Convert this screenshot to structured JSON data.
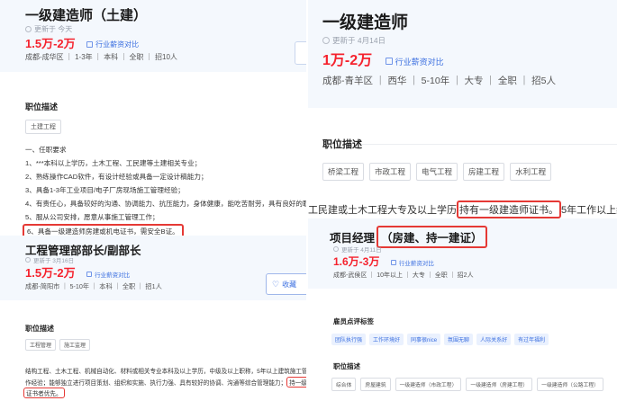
{
  "left": {
    "job1": {
      "title": "一级建造师（土建）",
      "updated": "更新于 今天",
      "salary": "1.5万-2万",
      "compare": "行业薪资对比",
      "meta": "成都-成华区 ｜ 1-3年 ｜ 本科 ｜ 全职 ｜ 招10人"
    },
    "desc": {
      "title": "职位描述",
      "tag": "土建工程",
      "lines": [
        "一、任职要求",
        "1、***本科以上学历，土木工程、工民建等土建相关专业；",
        "2、熟练操作CAD软件，有设计经验或具备一定设计稿能力；",
        "3、具备1-3年工业项目/电子厂房现场施工管理经验；",
        "4、有责任心，具备较好的沟通、协调能力、抗压能力，身体健康，能吃苦耐劳，具有良好的职业道德；",
        "5、服从公司安排，愿意从事施工管理工作；",
        "6、具备一级建造师房建或机电证书，需安全B证。"
      ]
    },
    "job2": {
      "title": "工程管理部部长/副部长",
      "updated": "更新于 3月16日",
      "salary": "1.5万-2万",
      "compare": "行业薪资对比",
      "meta": "成都-简阳市 ｜ 5-10年 ｜ 本科 ｜ 全职 ｜ 招1人",
      "favorite": "收藏"
    },
    "desc2": {
      "title": "职位描述",
      "tags": [
        "工程管理",
        "施工监理"
      ],
      "line1": "结构工程、土木工程、机械自动化、材料或相关专业本科及以上学历，中级及以上职称，5年以上建筑施工管理工",
      "line2_pre": "作经验；能够独立进行项目策划、组织和实施、执行力强、具有较好的协调、沟通等综合管理能力；",
      "line2_hl": "持一级建造师",
      "line3_hl": "证书者优先。"
    }
  },
  "right": {
    "job1": {
      "title": "一级建造师",
      "updated": "更新于 4月14日",
      "salary": "1万-2万",
      "compare": "行业薪资对比",
      "meta": "成都-青羊区 ｜ 西华 ｜ 5-10年 ｜ 大专 ｜ 全职 ｜ 招5人"
    },
    "desc": {
      "title": "职位描述",
      "tags": [
        "桥梁工程",
        "市政工程",
        "电气工程",
        "房建工程",
        "水利工程"
      ],
      "text_pre": "工民建或土木工程大专及以上学历",
      "text_hl": "持有一级建造师证书。",
      "text_post": "5年工作以上经历"
    },
    "job2": {
      "title": "项目经理",
      "title_hl": "（房建、持一建证）",
      "updated": "更新于 4月11日",
      "salary": "1.6万-3万",
      "compare": "行业薪资对比",
      "meta": "成都-武侯区 ｜ 10年以上 ｜ 大专 ｜ 全职 ｜ 招2人"
    },
    "review": {
      "title": "雇员点评标签",
      "tags": [
        "团队执行强",
        "工作环境好",
        "同事很nice",
        "氛围无聊",
        "人际关系好",
        "有过年福利"
      ]
    },
    "desc2": {
      "title": "职位描述",
      "tags": [
        "综合体",
        "房屋建筑",
        "一级建造师（市政工程）",
        "一级建造师（房建工程）",
        "一级建造师（公路工程）"
      ]
    }
  }
}
